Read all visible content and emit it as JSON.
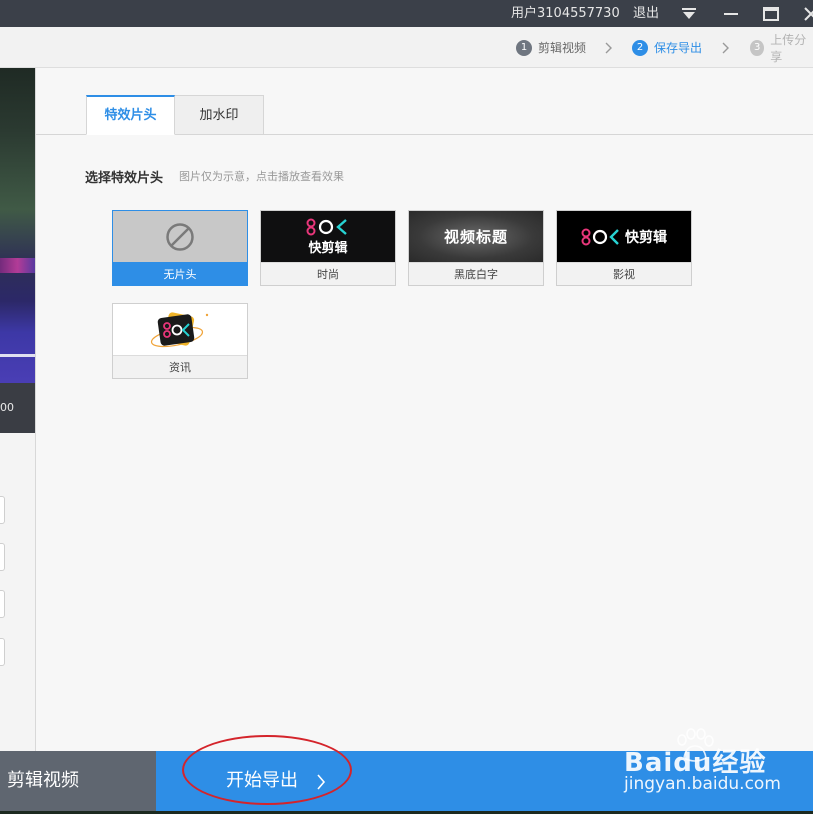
{
  "titlebar": {
    "user": "用户3104557730",
    "logout": "退出"
  },
  "steps": [
    {
      "num": "1",
      "label": "剪辑视频"
    },
    {
      "num": "2",
      "label": "保存导出"
    },
    {
      "num": "3",
      "label": "上传分享"
    }
  ],
  "preview": {
    "time_fragment": "00"
  },
  "tabs": [
    {
      "label": "特效片头",
      "active": true
    },
    {
      "label": "加水印",
      "active": false
    }
  ],
  "section": {
    "title": "选择特效片头",
    "hint": "图片仅为示意，点击播放查看效果"
  },
  "intro_cards": [
    {
      "label": "无片头",
      "selected": true
    },
    {
      "label": "时尚",
      "thumb_text": "快剪辑"
    },
    {
      "label": "黑底白字",
      "thumb_text": "视频标题"
    },
    {
      "label": "影视",
      "thumb_text": "快剪辑"
    },
    {
      "label": "资讯"
    }
  ],
  "bottom": {
    "edit_label": "剪辑视频",
    "export_label": "开始导出"
  },
  "watermark": {
    "brand": "Baidu经验",
    "url": "jingyan.baidu.com"
  },
  "colors": {
    "accent": "#2e8ee6",
    "titlebar": "#3b4049",
    "brand_pink": "#e8367a",
    "brand_cyan": "#27d3d3",
    "annotation": "#d4242b"
  }
}
